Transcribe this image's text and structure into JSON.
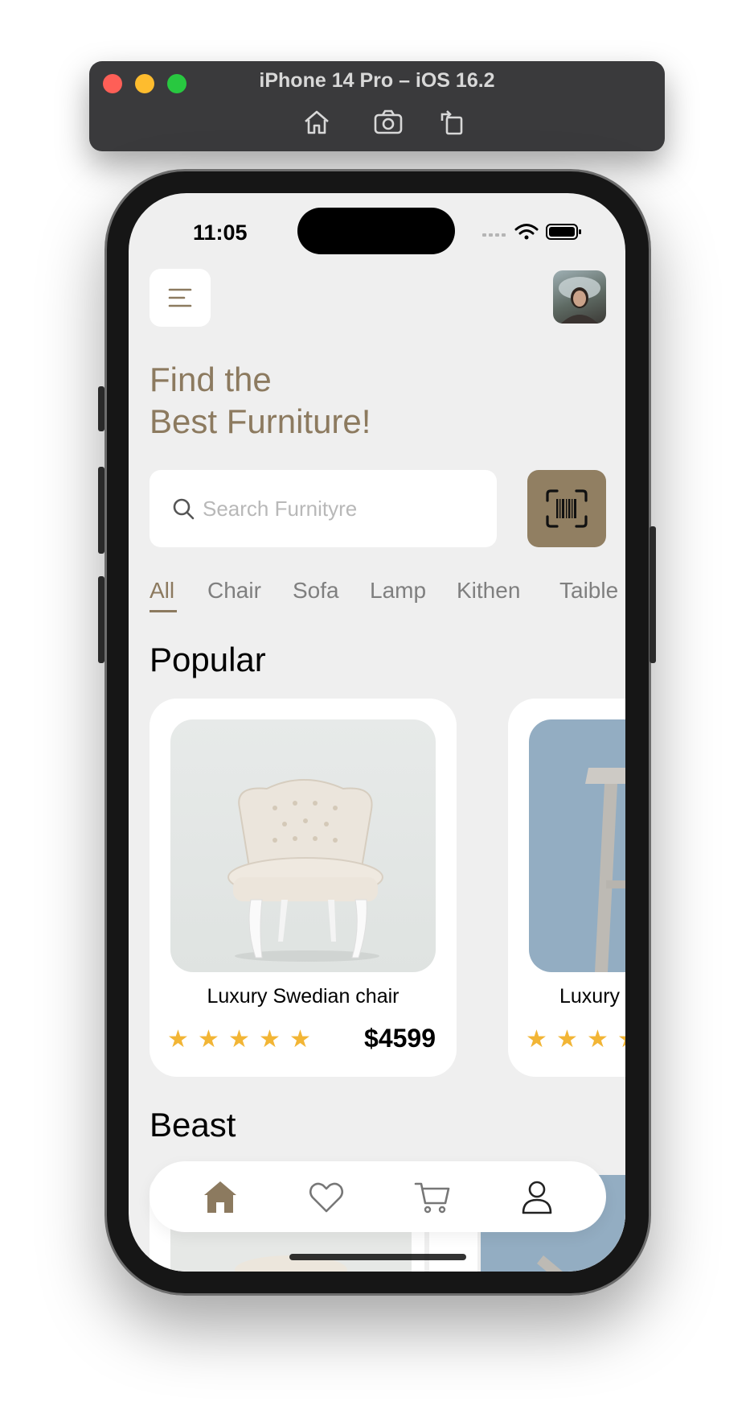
{
  "simulator": {
    "title": "iPhone 14 Pro – iOS 16.2",
    "tools": [
      "home-icon",
      "screenshot-icon",
      "rotate-icon"
    ]
  },
  "status_bar": {
    "time": "11:05"
  },
  "header": {
    "headline_line1": "Find the",
    "headline_line2": "Best Furniture!"
  },
  "search": {
    "placeholder": "Search Furnityre",
    "value": ""
  },
  "categories": [
    {
      "label": "All",
      "active": true
    },
    {
      "label": "Chair",
      "active": false
    },
    {
      "label": "Sofa",
      "active": false
    },
    {
      "label": "Lamp",
      "active": false
    },
    {
      "label": "Kithen",
      "active": false
    },
    {
      "label": "Taible",
      "active": false
    }
  ],
  "sections": {
    "popular_title": "Popular",
    "best_title": "Beast"
  },
  "popular_products": [
    {
      "name": "Luxury Swedian chair",
      "price": "$4599",
      "rating": 5
    },
    {
      "name": "Luxury",
      "price": "",
      "rating": 4
    }
  ],
  "tabbar": {
    "items": [
      "home-icon",
      "heart-icon",
      "cart-icon",
      "user-icon"
    ],
    "active": "home-icon"
  },
  "colors": {
    "accent": "#8c7a5f",
    "scan_button": "#917f62",
    "star": "#f2b535",
    "background": "#efefef"
  }
}
